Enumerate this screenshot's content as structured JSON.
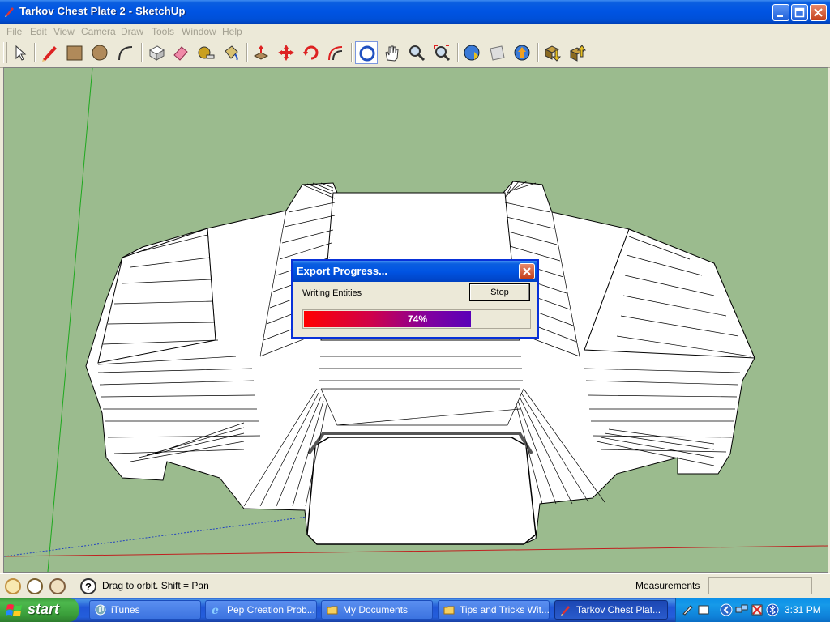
{
  "window": {
    "title": "Tarkov Chest Plate 2 - SketchUp",
    "controls": [
      "minimize-icon",
      "maximize-icon",
      "close-icon"
    ]
  },
  "menu": {
    "items": [
      "File",
      "Edit",
      "View",
      "Camera",
      "Draw",
      "Tools",
      "Window",
      "Help"
    ]
  },
  "toolbar": {
    "tools": [
      "select",
      "pencil",
      "rectangle",
      "circle",
      "arc",
      "make-component",
      "eraser",
      "tape-measure",
      "paint-bucket",
      "push-pull",
      "move",
      "rotate",
      "offset",
      "orbit",
      "pan",
      "zoom",
      "zoom-extents",
      "previous",
      "next",
      "get-models",
      "share-model",
      "get-photo-texture",
      "export"
    ],
    "active_tool": "orbit"
  },
  "dialog": {
    "title": "Export Progress...",
    "status": "Writing Entities",
    "stop_label": "Stop",
    "progress_text": "74%",
    "progress_value": 0.74
  },
  "statusbar": {
    "hint": "Drag to orbit.  Shift = Pan",
    "measurements_label": "Measurements",
    "measurements_value": ""
  },
  "taskbar": {
    "start_label": "start",
    "tasks": [
      {
        "label": "iTunes",
        "icon": "itunes-icon"
      },
      {
        "label": "Pep Creation Prob...",
        "icon": "ie-icon"
      },
      {
        "label": "My Documents",
        "icon": "folder-icon"
      },
      {
        "label": "Tips and Tricks Wit...",
        "icon": "folder-icon"
      },
      {
        "label": "Tarkov Chest Plat...",
        "icon": "sketchup-icon"
      }
    ],
    "clock": "3:31 PM"
  },
  "colors": {
    "viewport_bg": "#9bbb8e",
    "xp_blue": "#0054e3",
    "progress_start": "#ff0000",
    "progress_end": "#5a00b8"
  }
}
